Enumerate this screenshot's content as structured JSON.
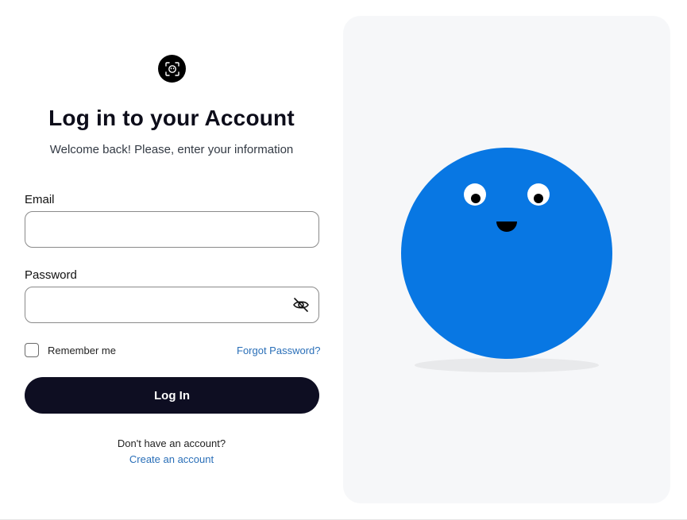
{
  "logo": {
    "icon": "scan-face-icon"
  },
  "heading": {
    "title": "Log in to your Account",
    "subtitle": "Welcome back! Please, enter your information"
  },
  "form": {
    "email_label": "Email",
    "email_value": "",
    "password_label": "Password",
    "password_value": "",
    "password_toggle_icon": "eye-off-icon",
    "remember_label": "Remember me",
    "remember_checked": false,
    "forgot_label": "Forgot Password?",
    "submit_label": "Log In"
  },
  "signup": {
    "prompt": "Don't have an account?",
    "link_label": "Create an account"
  },
  "illustration": {
    "character": "blue-ball-character",
    "colors": {
      "body": "#0877e3",
      "shadow": "#e8e9eb",
      "panel": "#f6f7f9"
    }
  },
  "colors": {
    "primary_button": "#0e0e22",
    "link": "#2a6fb8",
    "input_border": "#8a8a8a"
  }
}
